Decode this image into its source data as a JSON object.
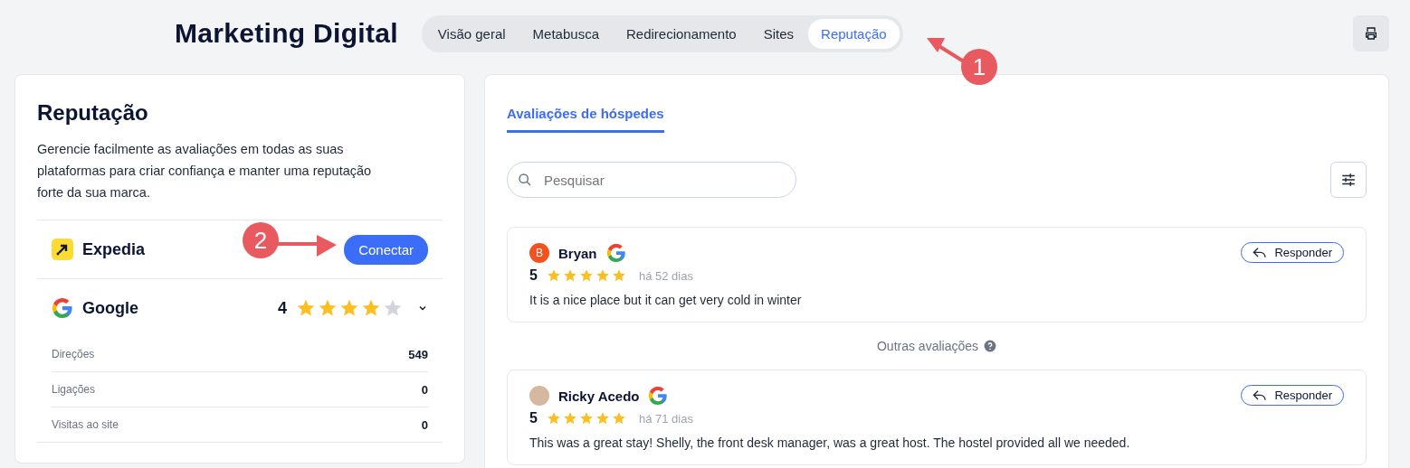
{
  "header": {
    "title": "Marketing Digital",
    "tabs": [
      {
        "label": "Visão geral",
        "selected": false
      },
      {
        "label": "Metabusca",
        "selected": false
      },
      {
        "label": "Redirecionamento",
        "selected": false
      },
      {
        "label": "Sites",
        "selected": false
      },
      {
        "label": "Reputação",
        "selected": true
      }
    ]
  },
  "sidebar": {
    "title": "Reputação",
    "description": "Gerencie facilmente as avaliações em todas as suas plataformas para criar confiança e manter uma reputação forte da sua marca.",
    "platforms": [
      {
        "kind": "connect",
        "name": "Expedia",
        "button": "Conectar"
      },
      {
        "kind": "rating",
        "name": "Google",
        "rating": "4",
        "stars": 4,
        "stats": [
          {
            "label": "Direções",
            "value": "549"
          },
          {
            "label": "Ligações",
            "value": "0"
          },
          {
            "label": "Visitas ao site",
            "value": "0"
          }
        ]
      }
    ]
  },
  "reviews_panel": {
    "tabs": [
      {
        "label": "Avaliações de hóspedes",
        "selected": true
      }
    ],
    "search": {
      "placeholder": "Pesquisar"
    },
    "reviews": [
      {
        "kind": "letter",
        "initial": "B",
        "name": "Bryan",
        "rating": "5",
        "stars": 5,
        "age": "há 52 dias",
        "text": "It is a nice place but it can get very cold in winter",
        "reply": "Responder"
      },
      {
        "kind": "photo",
        "name": "Ricky Acedo",
        "rating": "5",
        "stars": 5,
        "age": "há 71 dias",
        "text": "This was a great stay! Shelly, the front desk manager, was a great host. The hostel provided all we needed.",
        "reply": "Responder"
      }
    ],
    "divider_label": "Outras avaliações"
  },
  "annotations": [
    {
      "label": "1"
    },
    {
      "label": "2"
    }
  ]
}
